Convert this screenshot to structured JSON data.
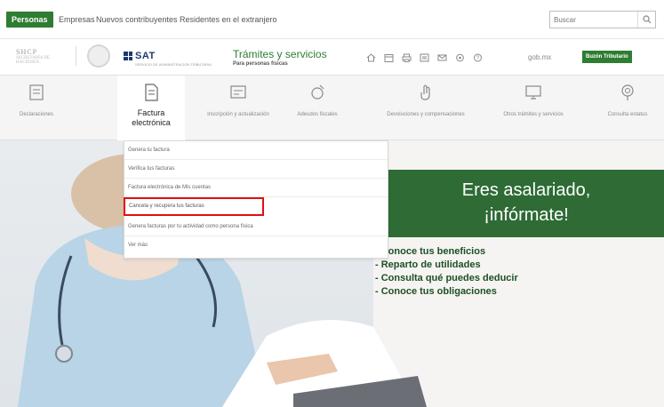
{
  "topbar": {
    "tabs": [
      {
        "label": "Personas",
        "active": true
      },
      {
        "label": "Empresas",
        "active": false
      },
      {
        "label": "Nuevos contribuyentes",
        "active": false
      },
      {
        "label": "Residentes en el extranjero",
        "active": false
      }
    ],
    "search_placeholder": "Buscar"
  },
  "header": {
    "hacienda_logo": "SHCP",
    "hacienda_sub": "SECRETARÍA DE HACIENDA",
    "sat_logo": "SAT",
    "sat_sub": "SERVICIO DE ADMINISTRACIÓN TRIBUTARIA",
    "tramites_title": "Trámites y servicios",
    "tramites_sub": "Para personas físicas",
    "gobmx": "gob.mx",
    "buzon_label": "Buzón Tributario",
    "icons": [
      "home-icon",
      "calendar-icon",
      "print-icon",
      "document-icon",
      "mail-icon",
      "settings-icon",
      "help-icon"
    ]
  },
  "nav": {
    "items": [
      {
        "label": "Declaraciones",
        "icon": "declaraciones-icon",
        "active": false
      },
      {
        "label": "Factura electrónica",
        "icon": "factura-icon",
        "active": true
      },
      {
        "label": "Inscripción y actualización",
        "icon": "inscripcion-icon",
        "active": false
      },
      {
        "label": "Adeudos fiscales",
        "icon": "adeudos-icon",
        "active": false
      },
      {
        "label": "Devoluciones y compensaciones",
        "icon": "devoluciones-icon",
        "active": false
      },
      {
        "label": "Otros trámites y servicios",
        "icon": "otros-icon",
        "active": false
      },
      {
        "label": "Consulta estatus",
        "icon": "consulta-icon",
        "active": false
      }
    ]
  },
  "dropdown": {
    "items": [
      {
        "label": "Genera tu factura",
        "highlighted": false
      },
      {
        "label": "Verifica tus facturas",
        "highlighted": false
      },
      {
        "label": "Factura electrónica de Mis cuentas",
        "highlighted": false
      },
      {
        "label": "Cancela y recupera tus facturas",
        "highlighted": true
      },
      {
        "label": "Genera facturas por tu actividad como persona física",
        "highlighted": false
      },
      {
        "label": "Ver más",
        "highlighted": false
      }
    ],
    "highlight_color": "#e01010"
  },
  "hero": {
    "promo_line1": "Eres asalariado,",
    "promo_line2": "¡infórmate!",
    "promo_color": "#2e6b35",
    "bullets": [
      "- Conoce tus beneficios",
      "- Reparto de utilidades",
      "- Consulta qué puedes deducir",
      "- Conoce tus obligaciones"
    ]
  },
  "colors": {
    "brand_green": "#2e7d32",
    "sat_blue": "#1a3a6d"
  }
}
